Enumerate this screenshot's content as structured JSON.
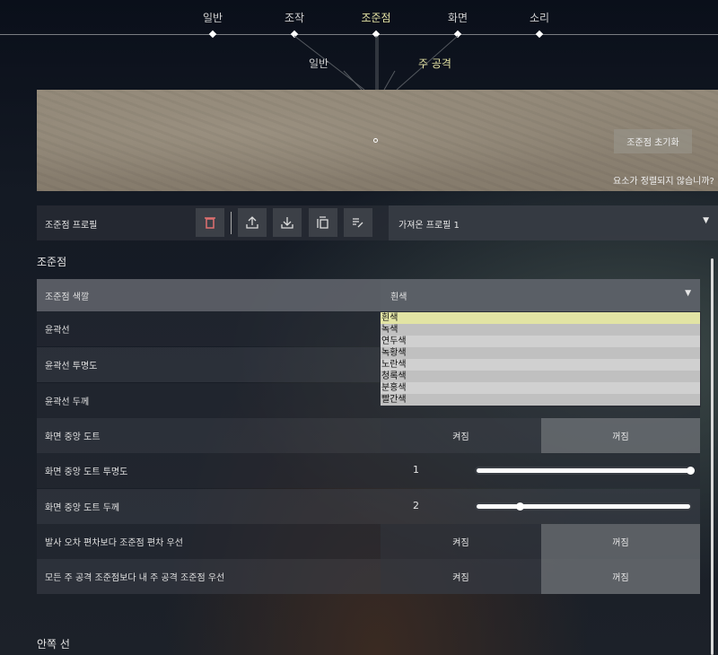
{
  "nav": {
    "tabs": [
      {
        "label": "일반"
      },
      {
        "label": "조작"
      },
      {
        "label": "조준점",
        "active": true
      },
      {
        "label": "화면"
      },
      {
        "label": "소리"
      }
    ],
    "subtabs": [
      {
        "label": "일반"
      },
      {
        "label": "주 공격",
        "active": true
      }
    ]
  },
  "preview": {
    "reset_label": "조준점 초기화",
    "misaligned_text": "요소가 정렬되지 않습니까?"
  },
  "profile": {
    "label": "조준점 프로필",
    "selected": "가져온 프로필 1",
    "icons": [
      "trash-icon",
      "upload-icon",
      "download-icon",
      "copy-icon",
      "rename-icon"
    ]
  },
  "section1": "조준점",
  "color": {
    "label": "조준점 색깔",
    "selected": "흰색",
    "options": [
      "흰색",
      "녹색",
      "연두색",
      "녹황색",
      "노란색",
      "청록색",
      "분홍색",
      "빨간색"
    ],
    "highlight": "#e2e4a4"
  },
  "rows": {
    "outline": "윤곽선",
    "outline_opacity": "윤곽선 투명도",
    "outline_thickness": "윤곽선 두께"
  },
  "center_dot": {
    "label": "화면 중앙 도트",
    "on": "켜짐",
    "off": "꺼짐",
    "value": "꺼짐"
  },
  "center_dot_opacity": {
    "label": "화면 중앙 도트 투명도",
    "value": "1",
    "fraction": 1.0
  },
  "center_dot_thickness": {
    "label": "화면 중앙 도트 두께",
    "value": "2",
    "fraction": 0.2
  },
  "fire_error": {
    "label": "발사 오차 편차보다 조준점 편차 우선",
    "on": "켜짐",
    "off": "꺼짐",
    "value": "꺼짐"
  },
  "my_primary": {
    "label": "모든 주 공격 조준점보다 내 주 공격 조준점 우선",
    "on": "켜짐",
    "off": "꺼짐",
    "value": "꺼짐"
  },
  "section2": "안쪽 선",
  "colors": {
    "accent": "#e4e2a4",
    "delete": "#e07070"
  }
}
